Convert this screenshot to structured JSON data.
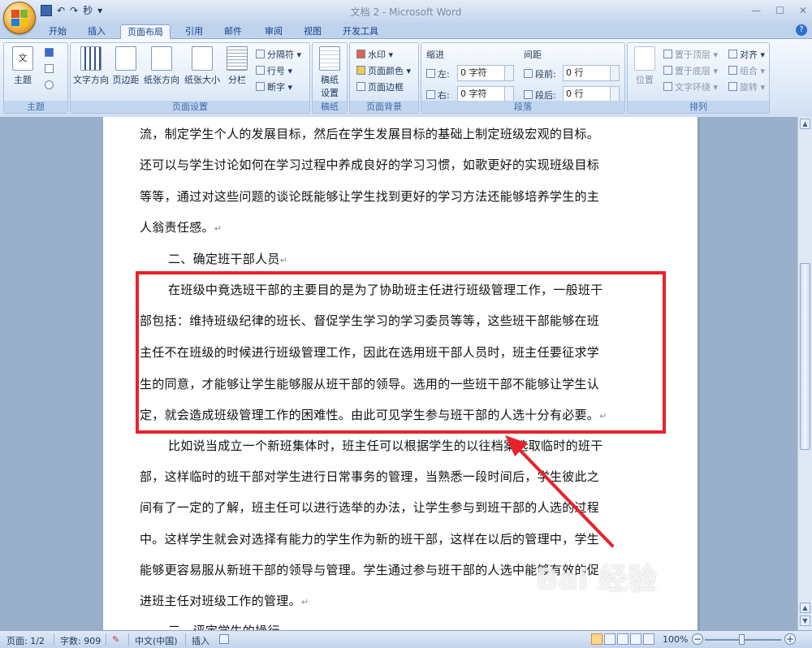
{
  "window": {
    "title": "文档 2 - Microsoft Word",
    "minimize": "—",
    "maximize": "☐",
    "close": "✕"
  },
  "qat": {
    "save_icon": "save-icon",
    "undo": "↶",
    "redo": "↷",
    "repeat": "秒",
    "customize": "▾"
  },
  "tabs": [
    "开始",
    "插入",
    "页面布局",
    "引用",
    "邮件",
    "审阅",
    "视图",
    "开发工具"
  ],
  "active_tab": "页面布局",
  "help": "?",
  "ribbon": {
    "theme": {
      "label": "主题",
      "btn": "主题",
      "text_a": "文"
    },
    "page_setup": {
      "label": "页面设置",
      "text_dir": "文字方向",
      "margins": "页边距",
      "orientation": "纸张方向",
      "size": "纸张大小",
      "columns": "分栏",
      "breaks": "分隔符",
      "line_numbers": "行号",
      "hyphenation": "断字"
    },
    "page_bg_group": {
      "draft_label": "稿纸",
      "draft_btn_1": "稿纸",
      "draft_btn_2": "设置"
    },
    "page_bg": {
      "label": "页面背景",
      "watermark": "水印",
      "page_color": "页面颜色",
      "page_border": "页面边框"
    },
    "paragraph": {
      "label": "段落",
      "indent": "缩进",
      "spacing": "间距",
      "left": "左:",
      "right": "右:",
      "before": "段前:",
      "after": "段后:",
      "left_val": "0 字符",
      "right_val": "0 字符",
      "before_val": "0 行",
      "after_val": "0 行"
    },
    "arrange": {
      "label": "排列",
      "position": "位置",
      "bring_front": "置于顶层",
      "send_back": "置于底层",
      "wrap": "文字环绕",
      "align": "对齐",
      "group": "组合",
      "rotate": "旋转"
    }
  },
  "document": {
    "lines": [
      "流，制定学生个人的发展目标，然后在学生发展目标的基础上制定班级宏观的目标。",
      "还可以与学生讨论如何在学习过程中养成良好的学习习惯，如歌更好的实现班级目标",
      "等等，通过对这些问题的谈论既能够让学生找到更好的学习方法还能够培养学生的主",
      "人翁责任感。",
      "二、确定班干部人员",
      "在班级中竟选班干部的主要目的是为了协助班主任进行班级管理工作，一般班干",
      "部包括：维持班级纪律的班长、督促学生学习的学习委员等等，这些班干部能够在班",
      "主任不在班级的时候进行班级管理工作，因此在选用班干部人员时，班主任要征求学",
      "生的同意，才能够让学生能够服从班干部的领导。选用的一些班干部不能够让学生认",
      "定，就会造成班级管理工作的困难性。由此可见学生参与班干部的人选十分有必要。",
      "比如说当成立一个新班集体时，班主任可以根据学生的以往档案选取临时的班干",
      "部，这样临时的班干部对学生进行日常事务的管理，当熟悉一段时间后，学生彼此之",
      "间有了一定的了解，班主任可以进行选举的办法，让学生参与到班干部的人选的过程",
      "中。这样学生就会对选择有能力的学生作为新的班干部，这样在以后的管理中，学生",
      "能够更容易服从新班干部的领导与管理。学生通过参与班干部的人选中能够有效的促",
      "进班主任对班级工作的管理。",
      "三、评定学生的操行"
    ],
    "para_mark": "↵"
  },
  "watermark": "Bai 经验",
  "status": {
    "page": "页面: 1/2",
    "words": "字数: 909",
    "language": "中文(中国)",
    "insert": "插入",
    "zoom": "100%",
    "zoom_minus": "−",
    "zoom_plus": "+"
  },
  "colors": {
    "highlight": "#e8222c",
    "ribbon": "#dce8f7",
    "doc_bg": "#9ab0ca"
  }
}
